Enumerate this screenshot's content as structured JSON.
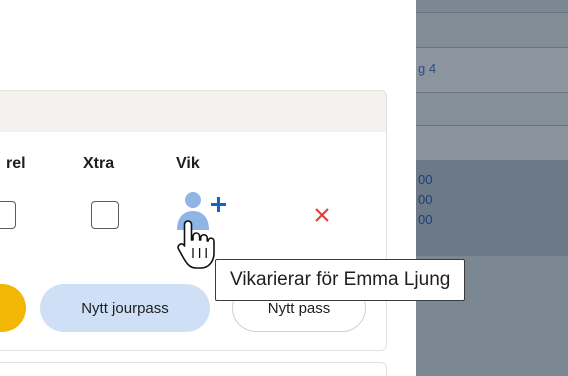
{
  "background_overlay": {
    "link_text": "g 4",
    "times": [
      "00",
      "00",
      "00"
    ]
  },
  "table": {
    "columns": {
      "rel": "rel",
      "xtra": "Xtra",
      "vik": "Vik"
    },
    "row": {
      "rel_checked": false,
      "xtra_checked": false,
      "vik_action_icon": "add-person-icon",
      "remove_icon": "close-icon"
    }
  },
  "actions": {
    "jourpass_label": "Nytt jourpass",
    "pass_label": "Nytt pass"
  },
  "tooltip": {
    "text": "Vikarierar för Emma Ljung"
  },
  "colors": {
    "accent_blue": "#1565c0",
    "person_icon": "#90b4e4",
    "remove_red": "#e53935",
    "jourpass_bg": "#cfe0f6",
    "yellow_pill": "#f2b705"
  }
}
